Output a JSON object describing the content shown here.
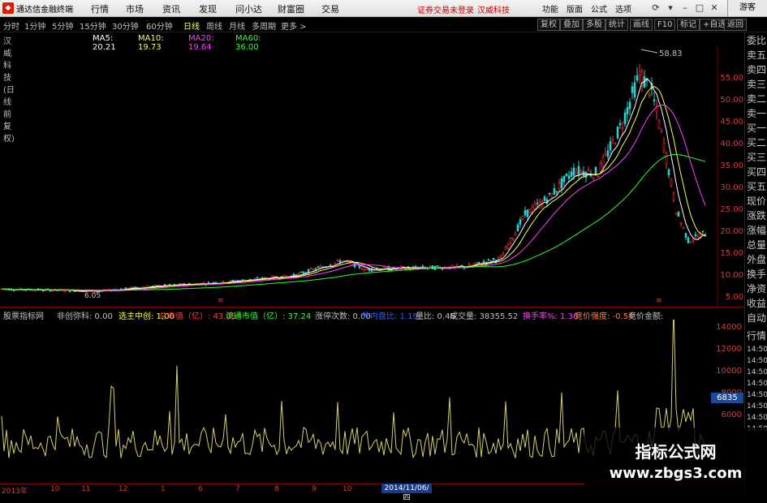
{
  "titlebar": {
    "logo": "◆",
    "app_name": "通达信金融终端",
    "menu": [
      "行情",
      "市场",
      "资讯",
      "发现",
      "问小达",
      "财富圈",
      "交易"
    ],
    "login_status": "证券交易未登录",
    "stock_name": "汉威科技",
    "right_menu": [
      "功能",
      "版面",
      "公式",
      "选项"
    ],
    "guest": "游客"
  },
  "toolbar": {
    "periods": [
      "分时",
      "1分钟",
      "5分钟",
      "15分钟",
      "30分钟",
      "60分钟",
      "日线",
      "周线",
      "月线",
      "多周期",
      "更多 >"
    ],
    "active": "日线",
    "buttons": [
      "复权",
      "叠加",
      "多股",
      "统计",
      "画线",
      "F10",
      "标记",
      "+自选",
      "返回"
    ]
  },
  "info": {
    "title": "汉威科技(日线 前复权)",
    "ma5": "MA5: 20.21",
    "ma10": "MA10: 19.73",
    "ma20": "MA20: 19.64",
    "ma60": "MA60: 36.00"
  },
  "price_axis": [
    "55.00",
    "50.00",
    "45.00",
    "40.00",
    "35.00",
    "30.00",
    "25.00",
    "20.00",
    "15.00",
    "10.00",
    "5.00"
  ],
  "annotations": {
    "high": "58.83",
    "low": "6.05"
  },
  "side_panel": [
    "委比",
    "卖五",
    "卖四",
    "卖三",
    "卖二",
    "卖一",
    "买一",
    "买二",
    "买三",
    "买四",
    "买五",
    "现价",
    "涨跌",
    "涨幅",
    "总量",
    "外盘",
    "换手",
    "净资",
    "收益",
    "自动",
    "行情",
    "14:50",
    "14:50",
    "14:50",
    "14:50",
    "14:50",
    "14:50",
    "14:50",
    "14:50"
  ],
  "indicator_line": [
    {
      "text": "股票指标网",
      "color": "#c0c0c0"
    },
    {
      "text": "非创弥科: 0.00",
      "color": "#c0c0c0"
    },
    {
      "text": "选主中创: 1.00",
      "color": "#ffff55"
    },
    {
      "text": "总市值（亿）: 43.09",
      "color": "#ff4040"
    },
    {
      "text": "流通市值（亿）: 37.24",
      "color": "#40ff40"
    },
    {
      "text": "涨停次数: 0.00",
      "color": "#c0c0c0"
    },
    {
      "text": "外内盘比: 1.19",
      "color": "#3060ff"
    },
    {
      "text": "量比: 0.46",
      "color": "#c0c0c0"
    },
    {
      "text": "成交量: 38355.52",
      "color": "#c0c0c0"
    },
    {
      "text": "换手率%: 1.36",
      "color": "#ff40ff"
    },
    {
      "text": "竞价强度: -0.54",
      "color": "#ff8040"
    },
    {
      "text": "竞价金额:",
      "color": "#c0c0c0"
    }
  ],
  "volume_axis": [
    "14000",
    "12000",
    "10000",
    "8000",
    "6000"
  ],
  "volume_marker": "6835",
  "bottom_axis": [
    "2013年",
    "10",
    "11",
    "12",
    "1",
    "6",
    "7",
    "8",
    "9",
    "10",
    "11"
  ],
  "date_highlight": "2014/11/06/四",
  "watermark": {
    "line1": "指标公式网",
    "line2": "www.zbgs3.com"
  },
  "colors": {
    "up": "#ff3030",
    "down": "#30d0d0",
    "ma5": "#ffffff",
    "ma10": "#ffff55",
    "ma20": "#ff40ff",
    "ma60": "#30ff30",
    "vol": "#d8d070"
  }
}
